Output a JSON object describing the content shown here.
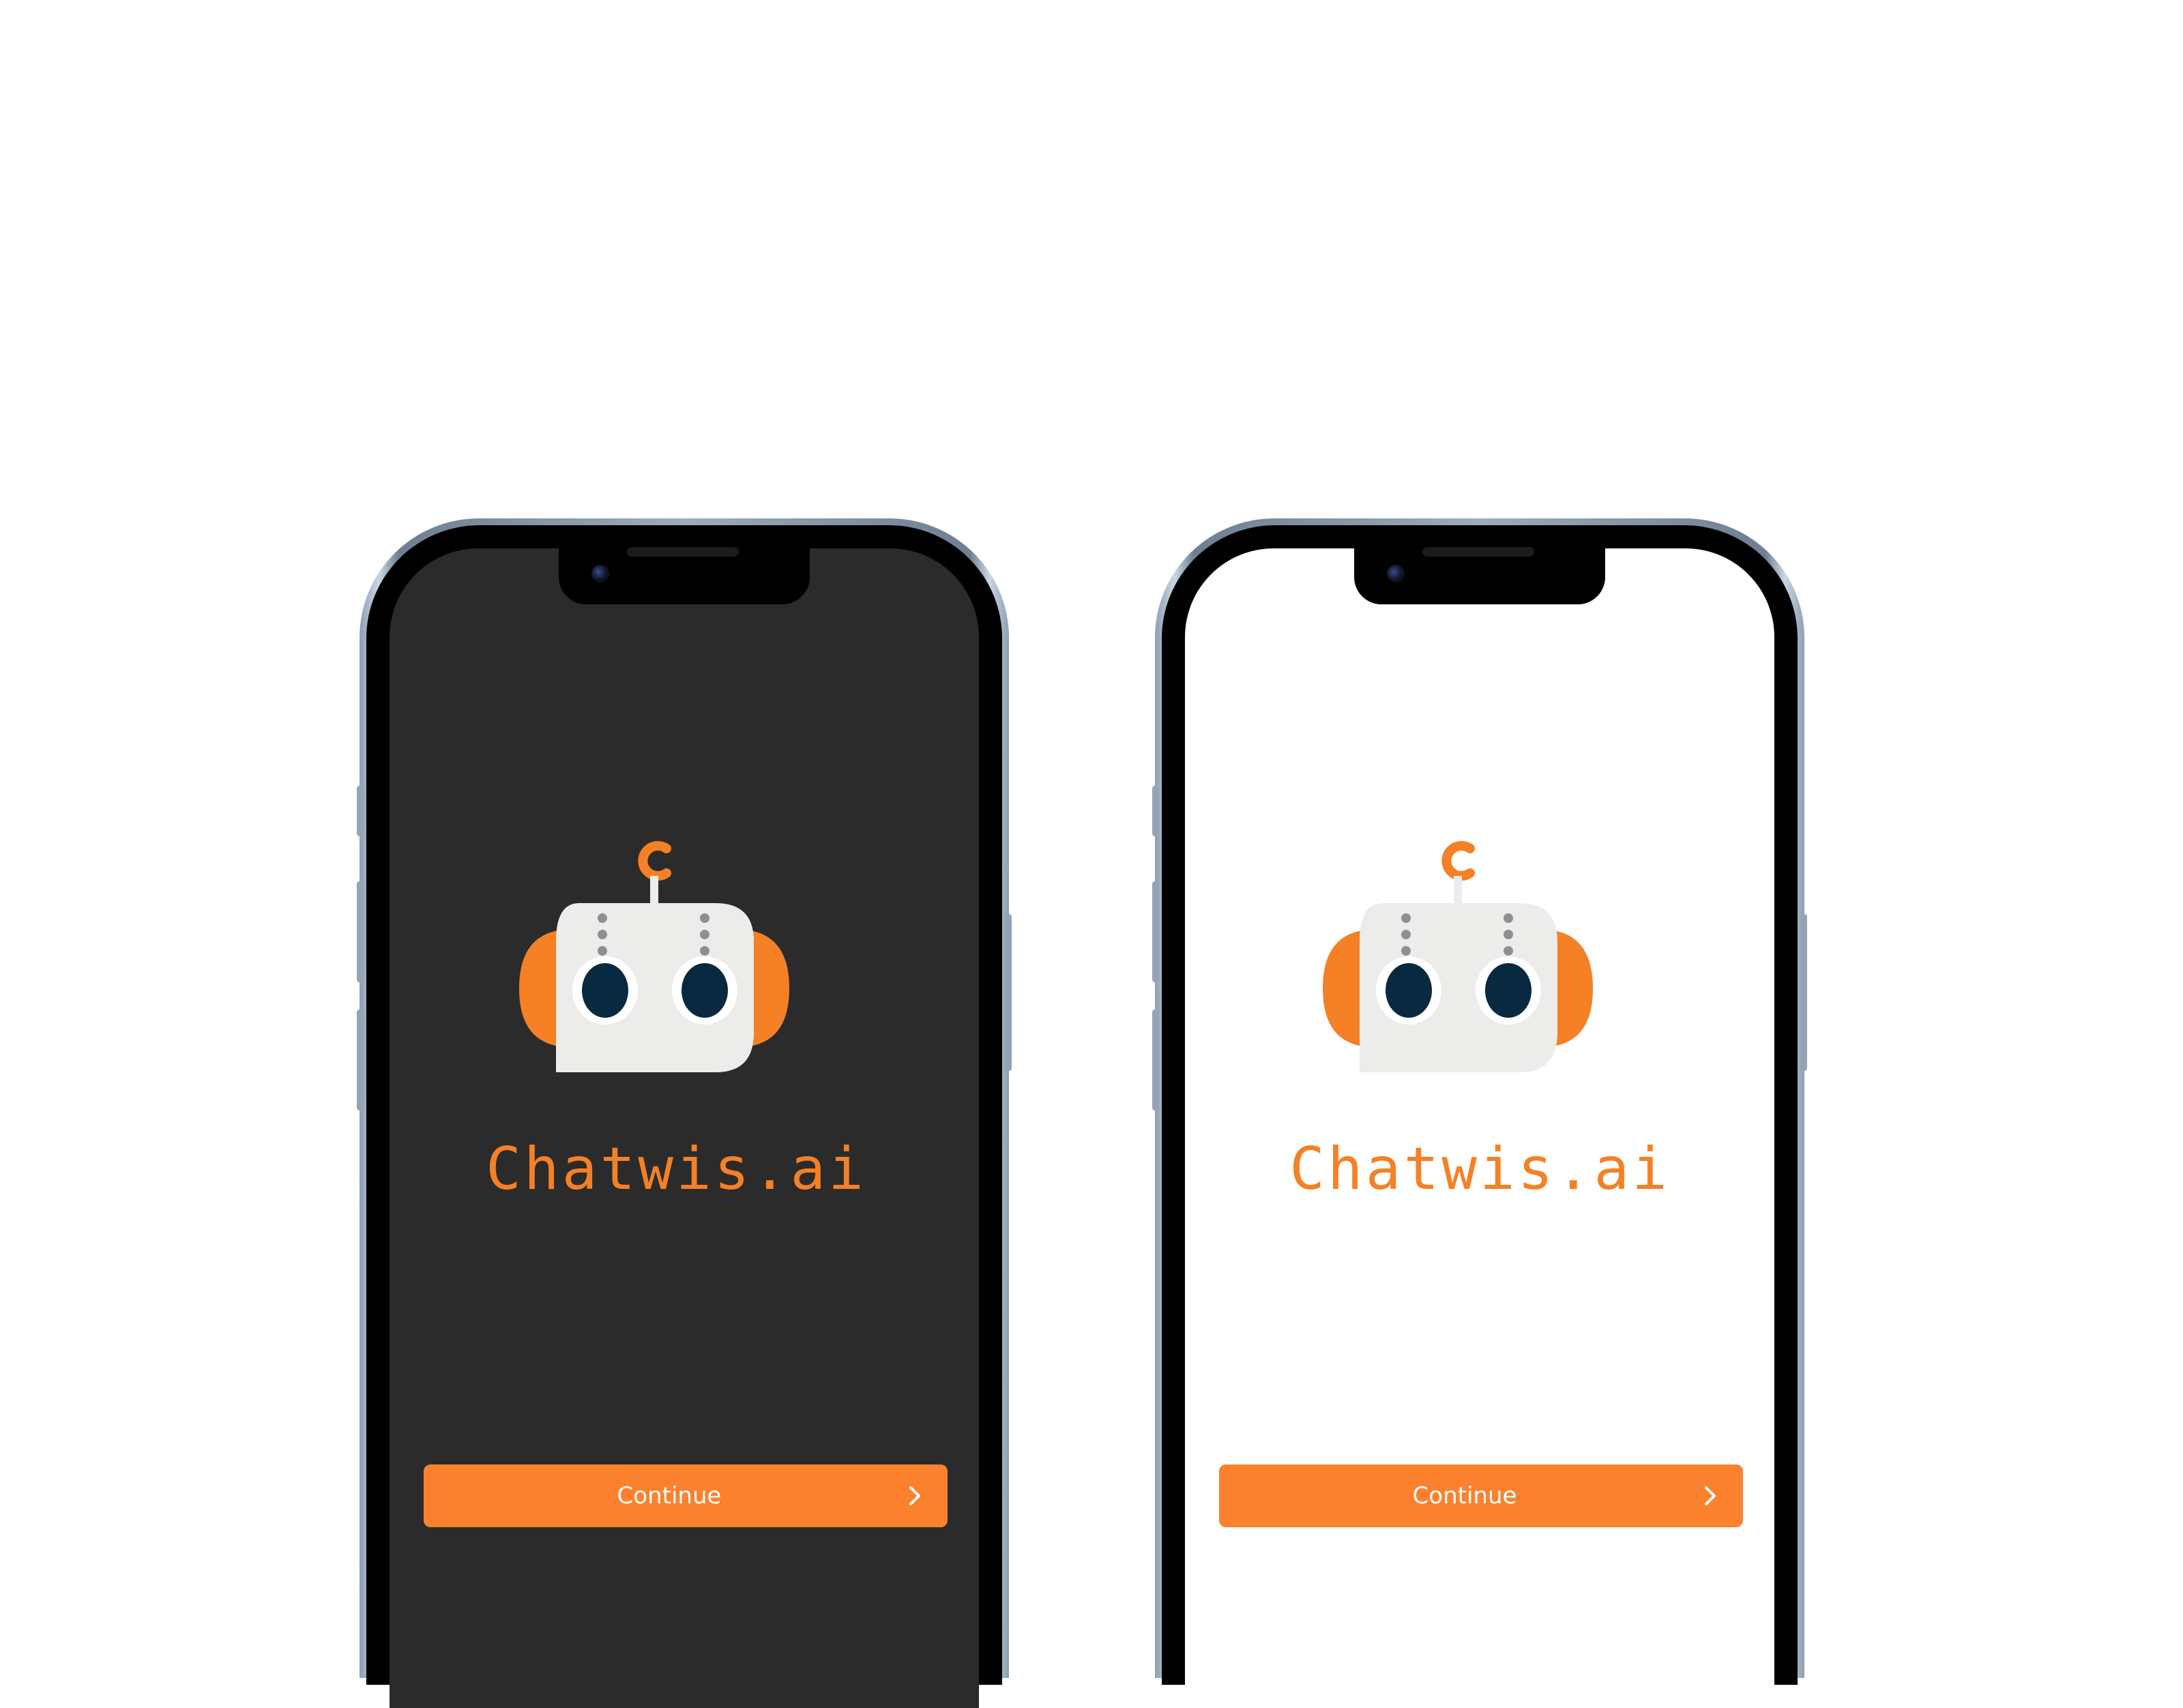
{
  "screens": [
    {
      "theme": "dark",
      "brand_name": "Chatwis.ai",
      "continue_label": "Continue",
      "chevron_icon": "chevron-right-icon"
    },
    {
      "theme": "light",
      "brand_name": "Chatwis.ai",
      "continue_label": "Continue",
      "chevron_icon": "chevron-right-icon"
    }
  ],
  "colors": {
    "accent": "#fb812e",
    "brand_text": "#f58025",
    "dark_background": "#2b2b2b",
    "light_background": "#ffffff",
    "robot_face": "#ececea",
    "robot_eye": "#082940"
  },
  "icons": {
    "logo": "robot-head-icon",
    "antenna_letter": "C"
  }
}
